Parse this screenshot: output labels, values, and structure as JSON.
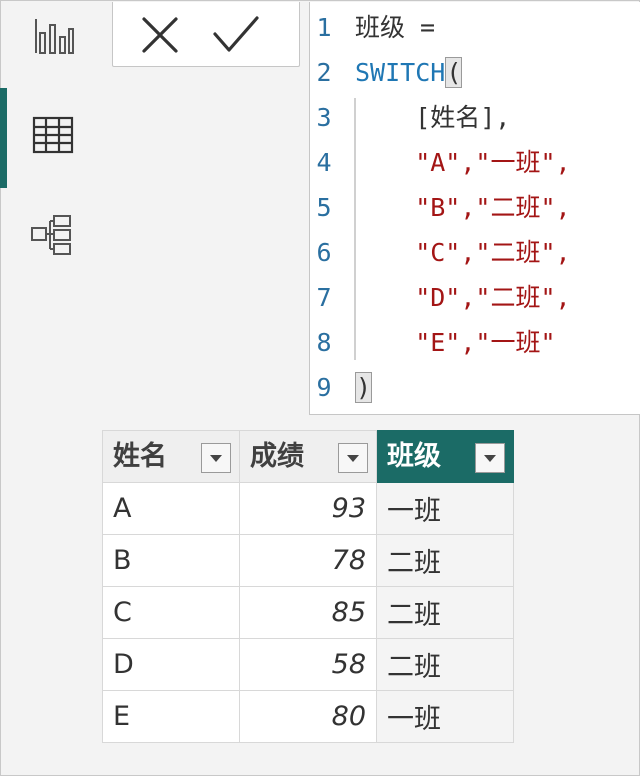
{
  "rail": {
    "icons": [
      "report-view-icon",
      "table-view-icon",
      "model-view-icon"
    ],
    "accent": "#1b6b66"
  },
  "commit": {
    "cancel_icon": "close-icon",
    "confirm_icon": "check-icon"
  },
  "editor": {
    "lines": [
      {
        "num": "1",
        "parts": [
          {
            "t": "班级 =",
            "c": "tx"
          }
        ]
      },
      {
        "num": "2",
        "parts": [
          {
            "t": "SWITCH",
            "c": "kw"
          },
          {
            "t": "(",
            "c": "tx",
            "hl": true
          }
        ]
      },
      {
        "num": "3",
        "parts": [
          {
            "t": "    [姓名],",
            "c": "tx"
          }
        ]
      },
      {
        "num": "4",
        "parts": [
          {
            "t": "    \"A\",\"一班\",",
            "c": "str"
          }
        ]
      },
      {
        "num": "5",
        "parts": [
          {
            "t": "    \"B\",\"二班\",",
            "c": "str"
          }
        ]
      },
      {
        "num": "6",
        "parts": [
          {
            "t": "    \"C\",\"二班\",",
            "c": "str"
          }
        ]
      },
      {
        "num": "7",
        "parts": [
          {
            "t": "    \"D\",\"二班\",",
            "c": "str"
          }
        ]
      },
      {
        "num": "8",
        "parts": [
          {
            "t": "    \"E\",\"一班\"",
            "c": "str"
          }
        ]
      },
      {
        "num": "9",
        "parts": [
          {
            "t": ")",
            "c": "tx",
            "hl": true
          }
        ]
      }
    ]
  },
  "table": {
    "headers": [
      "姓名",
      "成绩",
      "班级"
    ],
    "rows": [
      [
        "A",
        "93",
        "一班"
      ],
      [
        "B",
        "78",
        "二班"
      ],
      [
        "C",
        "85",
        "二班"
      ],
      [
        "D",
        "58",
        "二班"
      ],
      [
        "E",
        "80",
        "一班"
      ]
    ]
  }
}
